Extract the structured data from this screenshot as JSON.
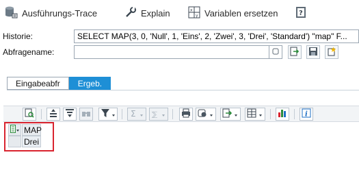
{
  "toolbar": {
    "trace_label": "Ausführungs-Trace",
    "explain_label": "Explain",
    "variables_label": "Variablen ersetzen"
  },
  "form": {
    "history_label": "Historie:",
    "history_value": "SELECT MAP(3, 0, 'Null', 1, 'Eins', 2, 'Zwei', 3, 'Drei', 'Standard') \"map\" F...",
    "queryname_label": "Abfragename:",
    "queryname_value": ""
  },
  "tabs": [
    {
      "label": "Eingabeabfr"
    },
    {
      "label": "Ergeb."
    }
  ],
  "grid": {
    "column_header": "MAP",
    "rows": [
      {
        "MAP": "Drei"
      }
    ]
  },
  "colors": {
    "active_tab": "#1e8fd6",
    "highlight_frame": "#d9232e"
  }
}
